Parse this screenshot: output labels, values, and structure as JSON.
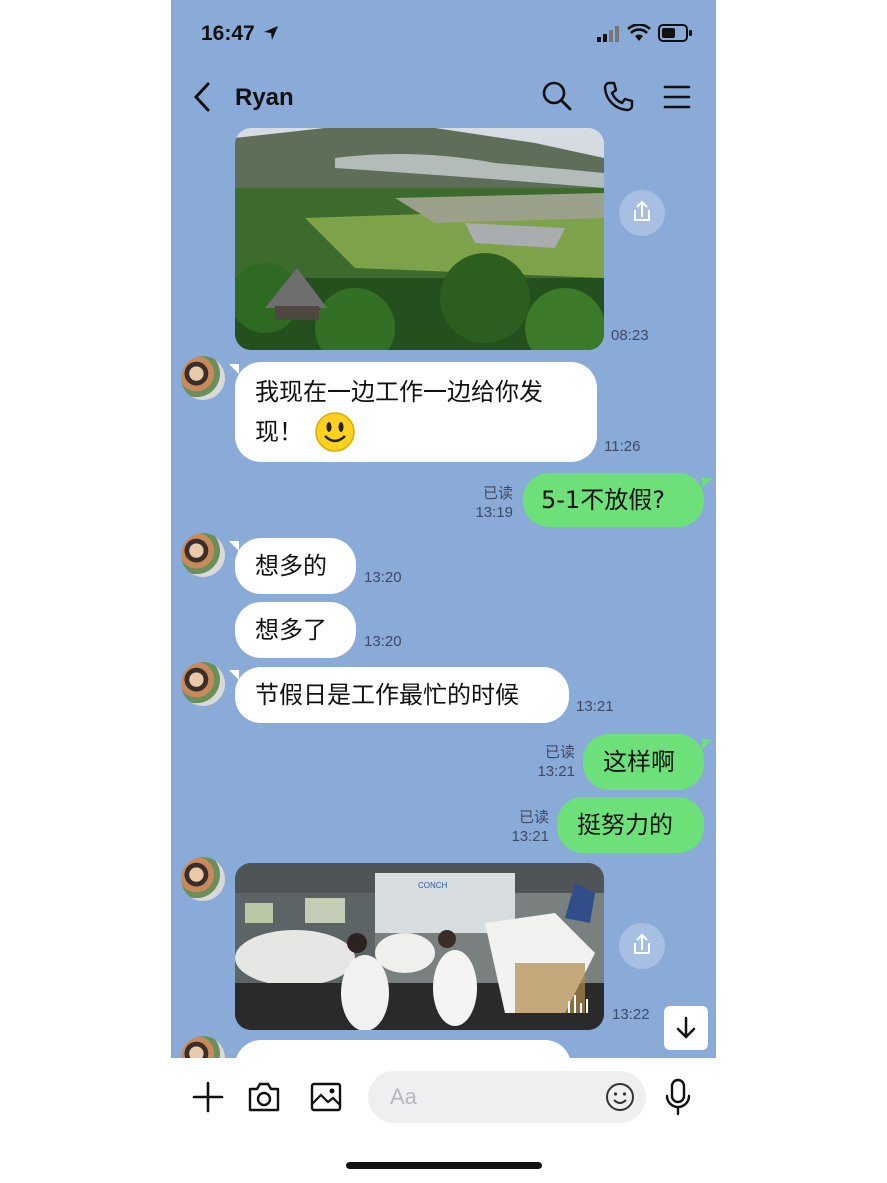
{
  "status_bar": {
    "time": "16:47"
  },
  "header": {
    "contact_name": "Ryan",
    "icons": [
      "back-icon",
      "search-icon",
      "phone-icon",
      "menu-icon"
    ]
  },
  "messages": [
    {
      "type": "image",
      "from": "Ryan",
      "time": "08:23"
    },
    {
      "type": "text",
      "from": "Ryan",
      "line1": "我现在一边工作一边给你发",
      "line2": "现！",
      "emoji": "smiley",
      "time": "11:26"
    },
    {
      "type": "text",
      "from": "me",
      "text": "5-1不放假?",
      "read": "已读",
      "time": "13:19"
    },
    {
      "type": "text",
      "from": "Ryan",
      "text": "想多的",
      "time": "13:20"
    },
    {
      "type": "text",
      "from": "Ryan",
      "text": "想多了",
      "time": "13:20"
    },
    {
      "type": "text",
      "from": "Ryan",
      "text": "节假日是工作最忙的时候",
      "time": "13:21"
    },
    {
      "type": "text",
      "from": "me",
      "text": "这样啊",
      "read": "已读",
      "time": "13:21"
    },
    {
      "type": "text",
      "from": "me",
      "text": "挺努力的",
      "read": "已读",
      "time": "13:21"
    },
    {
      "type": "video",
      "from": "Ryan",
      "time": "13:22",
      "sign_text": "CONCH"
    }
  ],
  "composer": {
    "placeholder": "Aa"
  },
  "colors": {
    "chat_background": "#8aaad8",
    "outgoing_bubble": "#6ee07a",
    "incoming_bubble": "#ffffff"
  }
}
